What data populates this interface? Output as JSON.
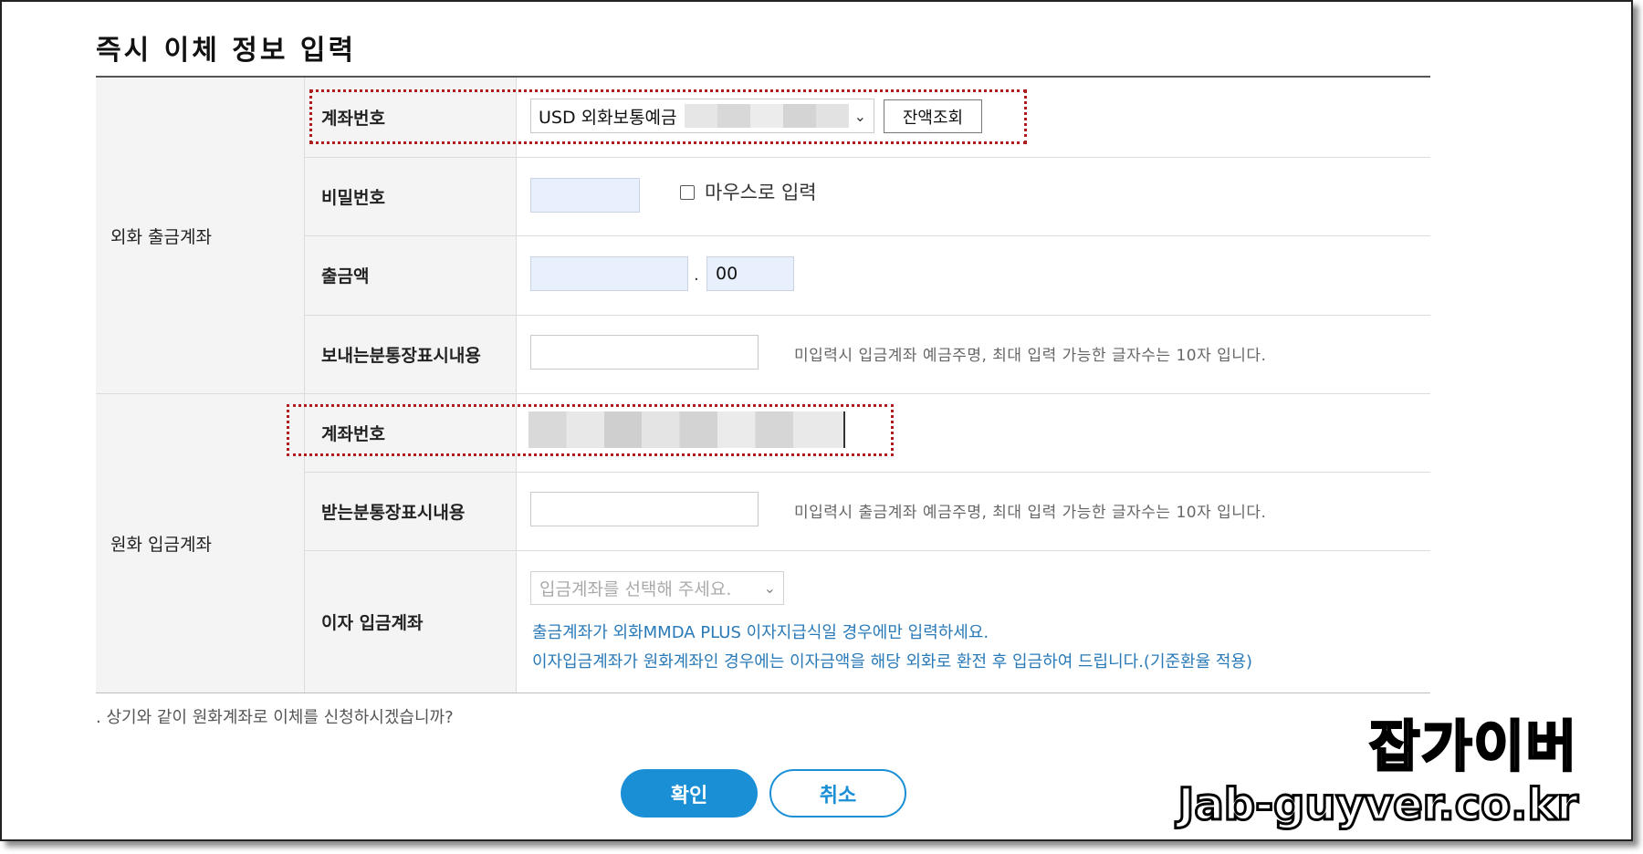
{
  "title": "즉시 이체 정보 입력",
  "sections": {
    "foreign_out": "외화 출금계좌",
    "won_in": "원화 입금계좌"
  },
  "labels": {
    "account_no": "계좌번호",
    "password": "비밀번호",
    "withdraw_amount": "출금액",
    "sender_memo": "보내는분통장표시내용",
    "account_no_2": "계좌번호",
    "receiver_memo": "받는분통장표시내용",
    "interest_account": "이자 입금계좌"
  },
  "account_select": {
    "value": "USD 외화보통예금"
  },
  "balance_button": "잔액조회",
  "mouse_input_label": "마우스로 입력",
  "amount_separator": ".",
  "amount_decimal": "00",
  "hints": {
    "sender": "미입력시 입금계좌 예금주명, 최대 입력 가능한 글자수는 10자 입니다.",
    "receiver": "미입력시 출금계좌 예금주명, 최대 입력 가능한 글자수는 10자 입니다."
  },
  "interest_select": {
    "placeholder": "입금계좌를 선택해 주세요."
  },
  "interest_notes": [
    "출금계좌가 외화MMDA PLUS 이자지급식일 경우에만 입력하세요.",
    "이자입금계좌가 원화계좌인 경우에는 이자금액을 해당 외화로 환전 후 입금하여 드립니다.(기준환율 적용)"
  ],
  "confirm_question": "상기와 같이 원화계좌로 이체를 신청하시겠습니까?",
  "buttons": {
    "ok": "확인",
    "cancel": "취소"
  },
  "watermark": {
    "korean": "잡가이버",
    "domain": "Jab-guyver.co.kr"
  },
  "colors": {
    "primary": "#1a8fd6",
    "highlight": "#b01c1c",
    "input_fill": "#e8f0fe"
  }
}
